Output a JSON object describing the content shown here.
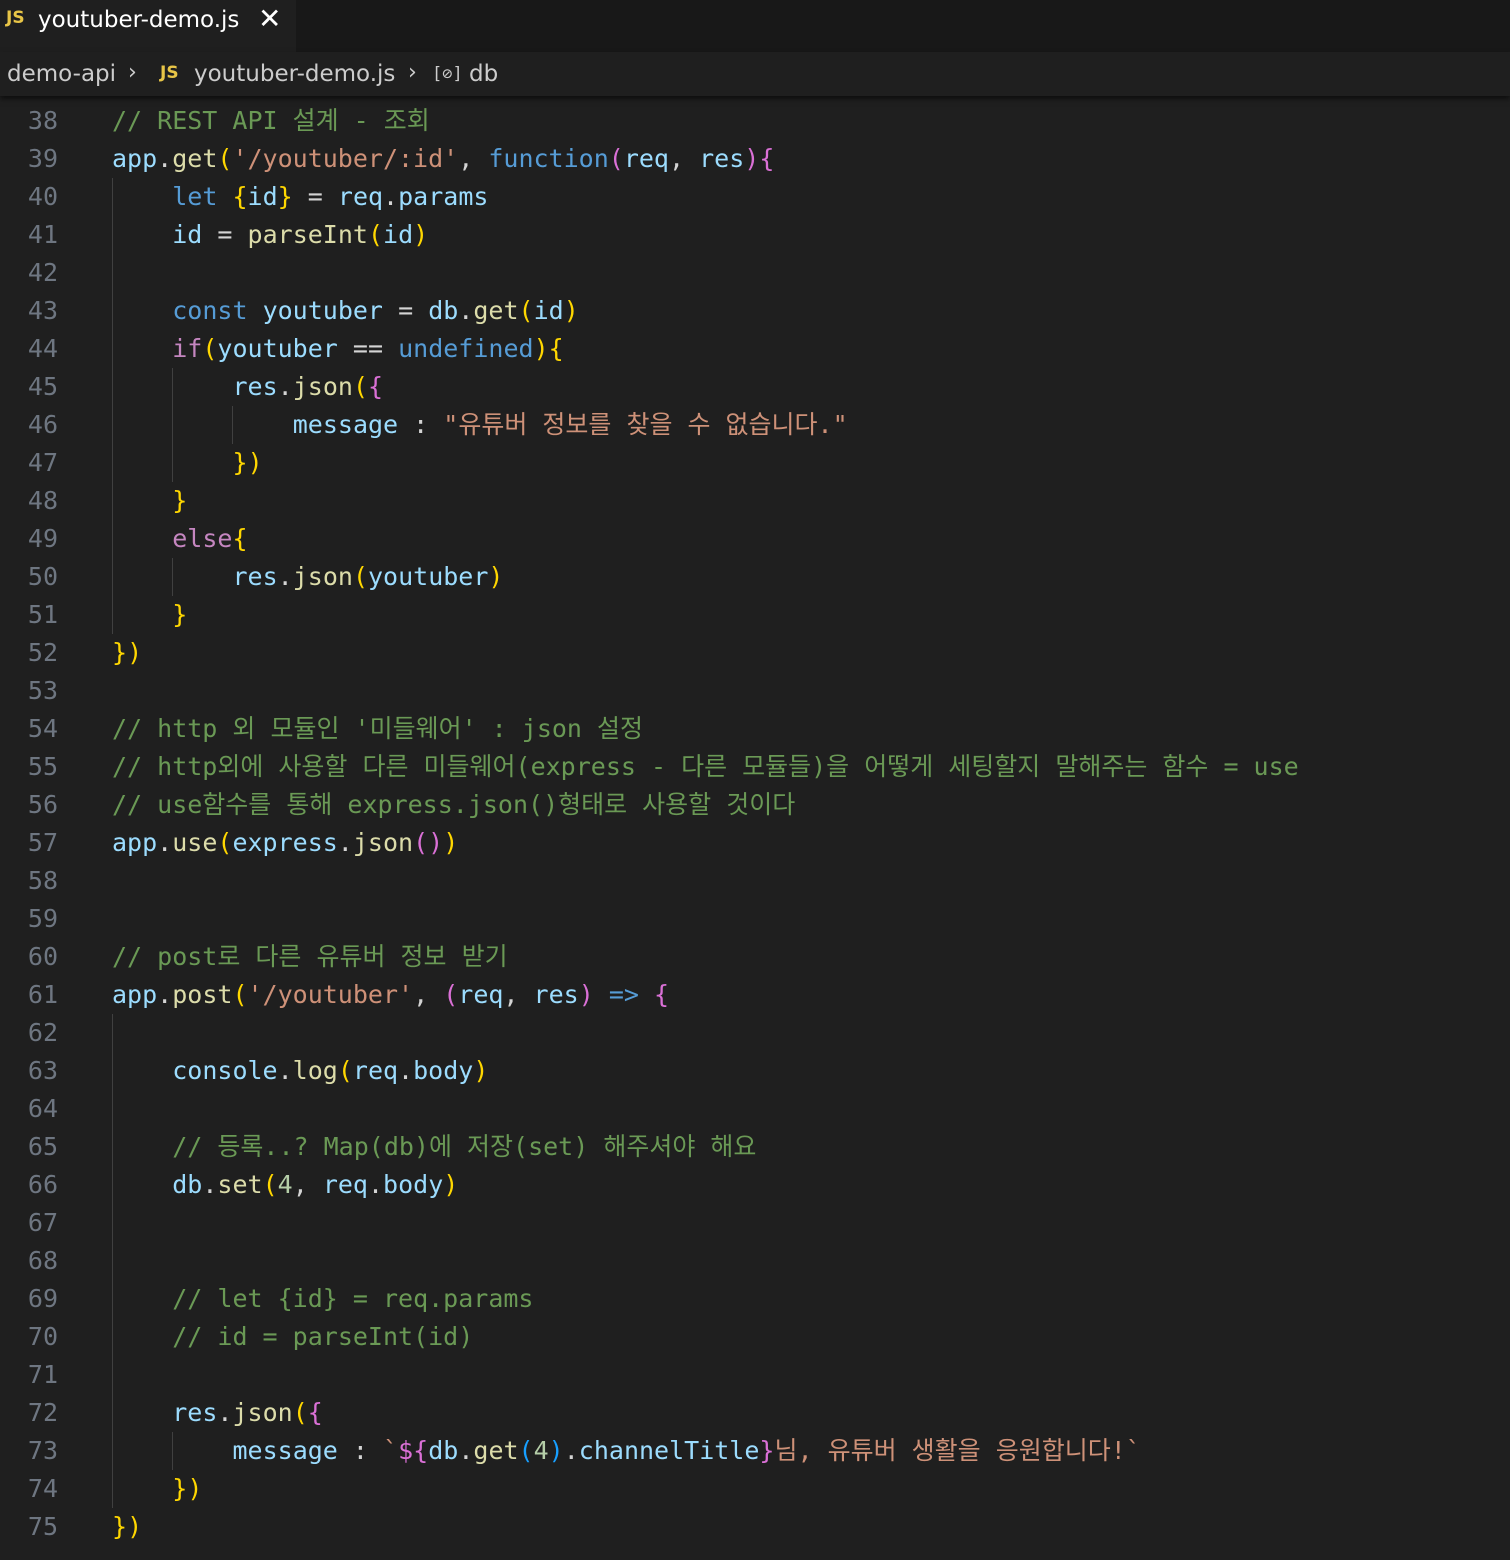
{
  "tab": {
    "badge": "JS",
    "title": "youtuber-demo.js",
    "close": "✕"
  },
  "breadcrumb": {
    "folder": "demo-api",
    "badge": "JS",
    "file": "youtuber-demo.js",
    "symbol_icon": "[⊘]",
    "symbol": "db",
    "separator": "›"
  },
  "editor": {
    "language": "javascript",
    "first_line": 38,
    "lines": [
      "// REST API 설계 - 조회",
      "app.get('/youtuber/:id', function(req, res){",
      "    let {id} = req.params",
      "    id = parseInt(id)",
      "",
      "    const youtuber = db.get(id)",
      "    if(youtuber == undefined){",
      "        res.json({",
      "            message : \"유튜버 정보를 찾을 수 없습니다.\"",
      "        })",
      "    }",
      "    else{",
      "        res.json(youtuber)",
      "    }",
      "})",
      "",
      "// http 외 모듈인 '미들웨어' : json 설정",
      "// http외에 사용할 다른 미들웨어(express - 다른 모듈들)을 어떻게 세팅할지 말해주는 함수 = use",
      "// use함수를 통해 express.json()형태로 사용할 것이다",
      "app.use(express.json())",
      "",
      "",
      "// post로 다른 유튜버 정보 받기",
      "app.post('/youtuber', (req, res) => {",
      "",
      "    console.log(req.body)",
      "",
      "    // 등록..? Map(db)에 저장(set) 해주셔야 해요",
      "    db.set(4, req.body)",
      "",
      "",
      "    // let {id} = req.params",
      "    // id = parseInt(id)",
      "",
      "    res.json({",
      "        message : `${db.get(4).channelTitle}님, 유튜버 생활을 응원합니다!`",
      "    })",
      "})"
    ]
  }
}
